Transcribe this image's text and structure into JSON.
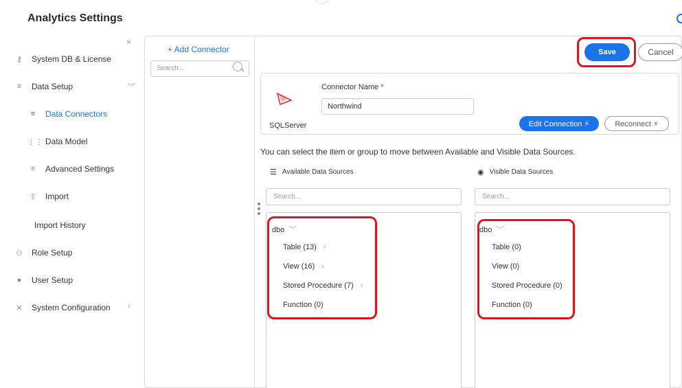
{
  "app": {
    "title": "Analytics Settings"
  },
  "sidebar": {
    "close": "×",
    "items": [
      {
        "label": "System DB & License",
        "icon": "key-icon"
      },
      {
        "label": "Data Setup",
        "icon": "data-setup-icon"
      },
      {
        "label": "Data Connectors",
        "icon": "data-connectors-icon"
      },
      {
        "label": "Data Model",
        "icon": "grid-icon"
      },
      {
        "label": "Advanced Settings",
        "icon": "list-settings-icon"
      },
      {
        "label": "Import",
        "icon": "import-icon"
      },
      {
        "label": "Import History",
        "icon": ""
      },
      {
        "label": "Role Setup",
        "icon": "users-icon"
      },
      {
        "label": "User Setup",
        "icon": "user-icon"
      },
      {
        "label": "System Configuration",
        "icon": "tools-icon"
      }
    ]
  },
  "connectors": {
    "add_label": "+ Add Connector",
    "search_placeholder": "Search..."
  },
  "actions": {
    "save": "Save",
    "cancel": "Cancel"
  },
  "connector": {
    "name_label": "Connector Name",
    "required_mark": "*",
    "name_value": "Northwind",
    "type_label": "SQLServer",
    "edit_connection": "Edit Connection ⚡",
    "reconnect": "Reconnect ⚡"
  },
  "instructions": "You can select the item or group to move between Available and Visible Data Sources.",
  "available": {
    "title": "Available Data Sources",
    "search_placeholder": "Search...",
    "root": "dbo",
    "items": [
      "Table (13)",
      "View (16)",
      "Stored Procedure (7)",
      "Function (0)"
    ]
  },
  "visible": {
    "title": "Visible Data Sources",
    "search_placeholder": "Search...",
    "root": "dbo",
    "items": [
      "Table (0)",
      "View (0)",
      "Stored Procedure (0)",
      "Function (0)"
    ]
  },
  "colors": {
    "accent": "#1a73e8",
    "highlight": "#e0141e"
  }
}
